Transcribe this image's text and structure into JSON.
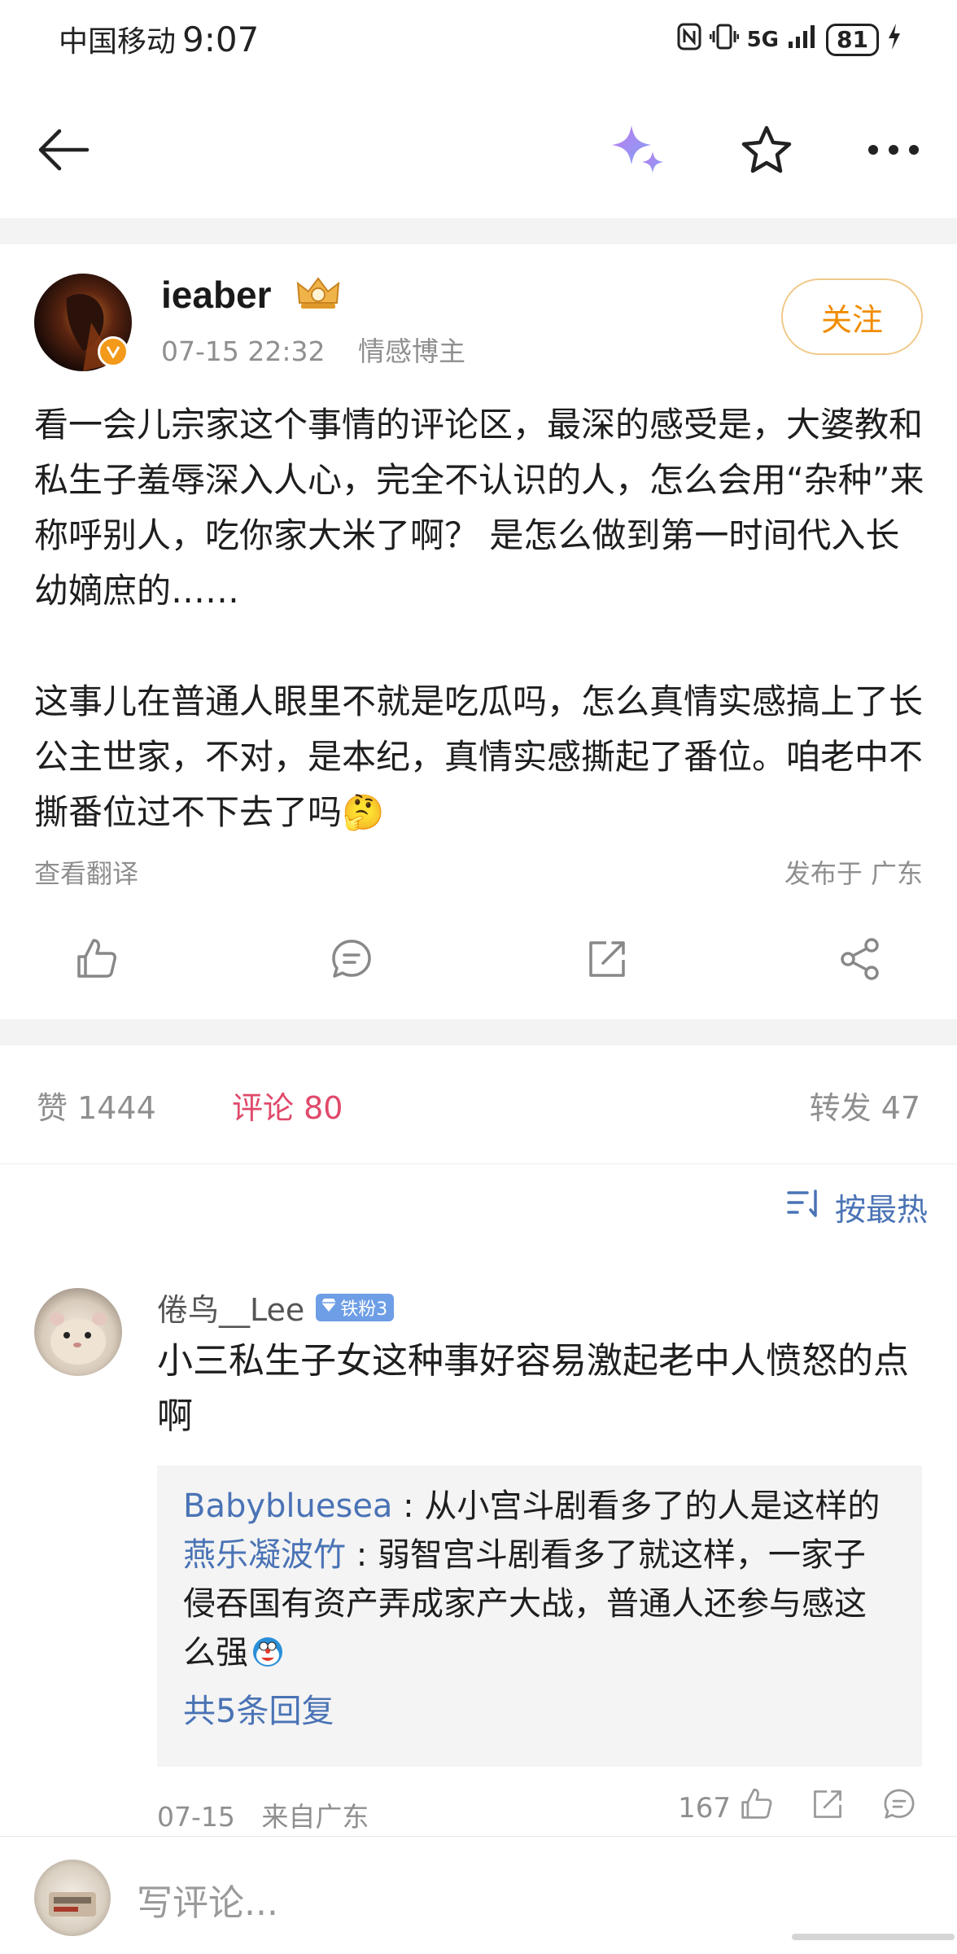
{
  "status_bar": {
    "carrier": "中国移动",
    "time": "9:07",
    "network": "5G",
    "battery": "81"
  },
  "nav": {
    "icons": [
      "back-arrow-icon",
      "sparkle-icon",
      "star-icon",
      "more-icon"
    ],
    "accent": "#a98ef0"
  },
  "post": {
    "author": "ieaber",
    "timestamp": "07-15 22:32",
    "author_tag": "情感博主",
    "follow_label": "关注",
    "paragraph_1": "看一会儿宗家这个事情的评论区，最深的感受是，大婆教和私生子羞辱深入人心，完全不认识的人，怎么会用“杂种”来称呼别人，吃你家大米了啊？ 是怎么做到第一时间代入长幼嫡庶的……",
    "paragraph_2": "这事儿在普通人眼里不就是吃瓜吗，怎么真情实感搞上了长公主世家，不对，是本纪，真情实感撕起了番位。咱老中不撕番位过不下去了吗",
    "emoji": "🤔",
    "translate_label": "查看翻译",
    "location": "发布于 广东"
  },
  "stats": {
    "likes_label": "赞 1444",
    "comments_label": "评论 80",
    "reposts_label": "转发 47",
    "active_color": "#e0496a"
  },
  "sort": {
    "label": "按最热"
  },
  "comment": {
    "username": "倦鸟__Lee",
    "badge": "铁粉3",
    "text": "小三私生子女这种事好容易激起老中人愤怒的点啊",
    "replies": [
      {
        "user": "Babybluesea",
        "text": "从小宫斗剧看多了的人是这样的"
      },
      {
        "user": "燕乐凝波竹",
        "text": "弱智宫斗剧看多了就这样，一家子侵吞国有资产弄成家产大战，普通人还参与感这么强"
      }
    ],
    "more_replies": "共5条回复",
    "date": "07-15",
    "from": "来自广东",
    "likes": "167"
  },
  "bottom_bar": {
    "placeholder": "写评论..."
  }
}
